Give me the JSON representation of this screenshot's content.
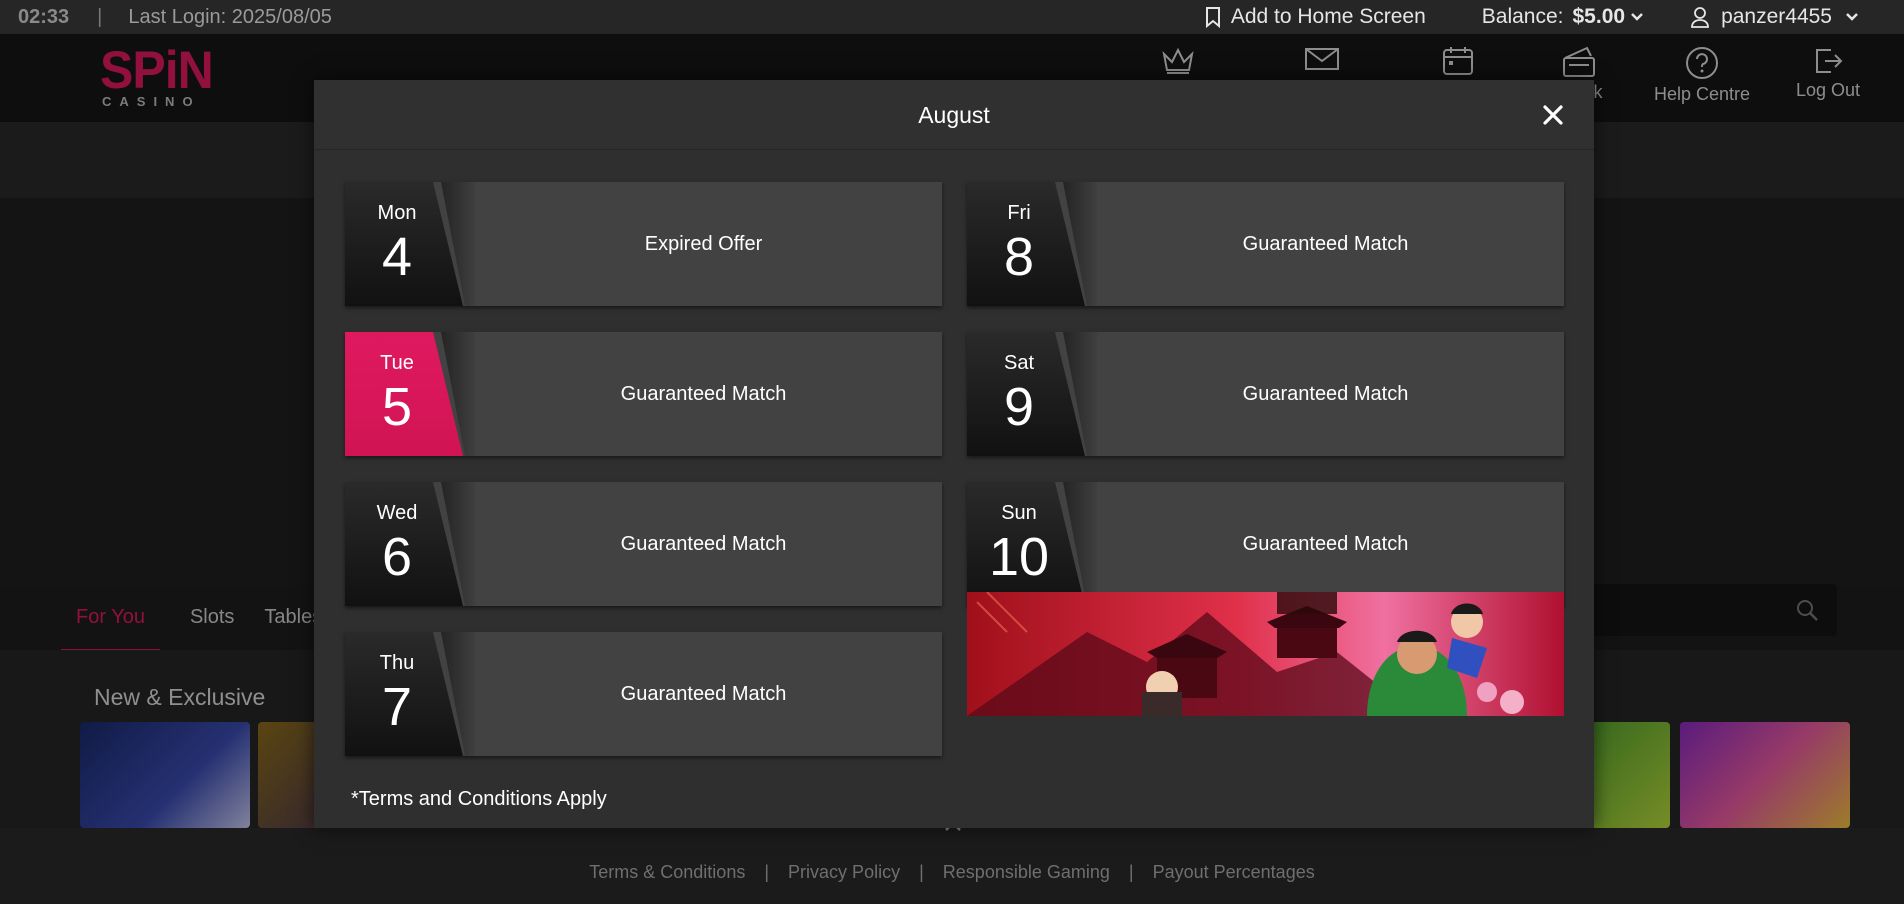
{
  "topbar": {
    "time": "02:33",
    "separator": "|",
    "last_login": "Last Login: 2025/08/05",
    "add_home": "Add to Home Screen",
    "balance_label": "Balance:",
    "balance_value": "$5.00",
    "username": "panzer4455"
  },
  "header": {
    "logo_main": "SPiN",
    "logo_sub": "CASINO",
    "nav": [
      {
        "label": "",
        "icon": "crown-icon"
      },
      {
        "label": "",
        "icon": "mail-icon"
      },
      {
        "label": "",
        "icon": "calendar-icon"
      },
      {
        "label": "k",
        "icon": "wallet-icon"
      },
      {
        "label": "Help Centre",
        "icon": "help-icon"
      },
      {
        "label": "Log Out",
        "icon": "logout-icon"
      }
    ]
  },
  "tabs": [
    "For You",
    "Slots",
    "Tables"
  ],
  "section_title": "New & Exclusive",
  "modal": {
    "title": "August",
    "terms": "*Terms and Conditions Apply",
    "cards": [
      {
        "dow": "Mon",
        "num": "4",
        "label": "Expired Offer",
        "active": false
      },
      {
        "dow": "Fri",
        "num": "8",
        "label": "Guaranteed Match",
        "active": false
      },
      {
        "dow": "Tue",
        "num": "5",
        "label": "Guaranteed Match",
        "active": true
      },
      {
        "dow": "Sat",
        "num": "9",
        "label": "Guaranteed Match",
        "active": false
      },
      {
        "dow": "Wed",
        "num": "6",
        "label": "Guaranteed Match",
        "active": false
      },
      {
        "dow": "Sun",
        "num": "10",
        "label": "Guaranteed Match",
        "active": false
      },
      {
        "dow": "Thu",
        "num": "7",
        "label": "Guaranteed Match",
        "active": false
      }
    ]
  },
  "footer": {
    "links": [
      "Terms & Conditions",
      "Privacy Policy",
      "Responsible Gaming",
      "Payout Percentages"
    ],
    "separator": "|"
  },
  "colors": {
    "accent": "#e0195f",
    "card": "#424242",
    "modal": "#2f2f2f"
  }
}
